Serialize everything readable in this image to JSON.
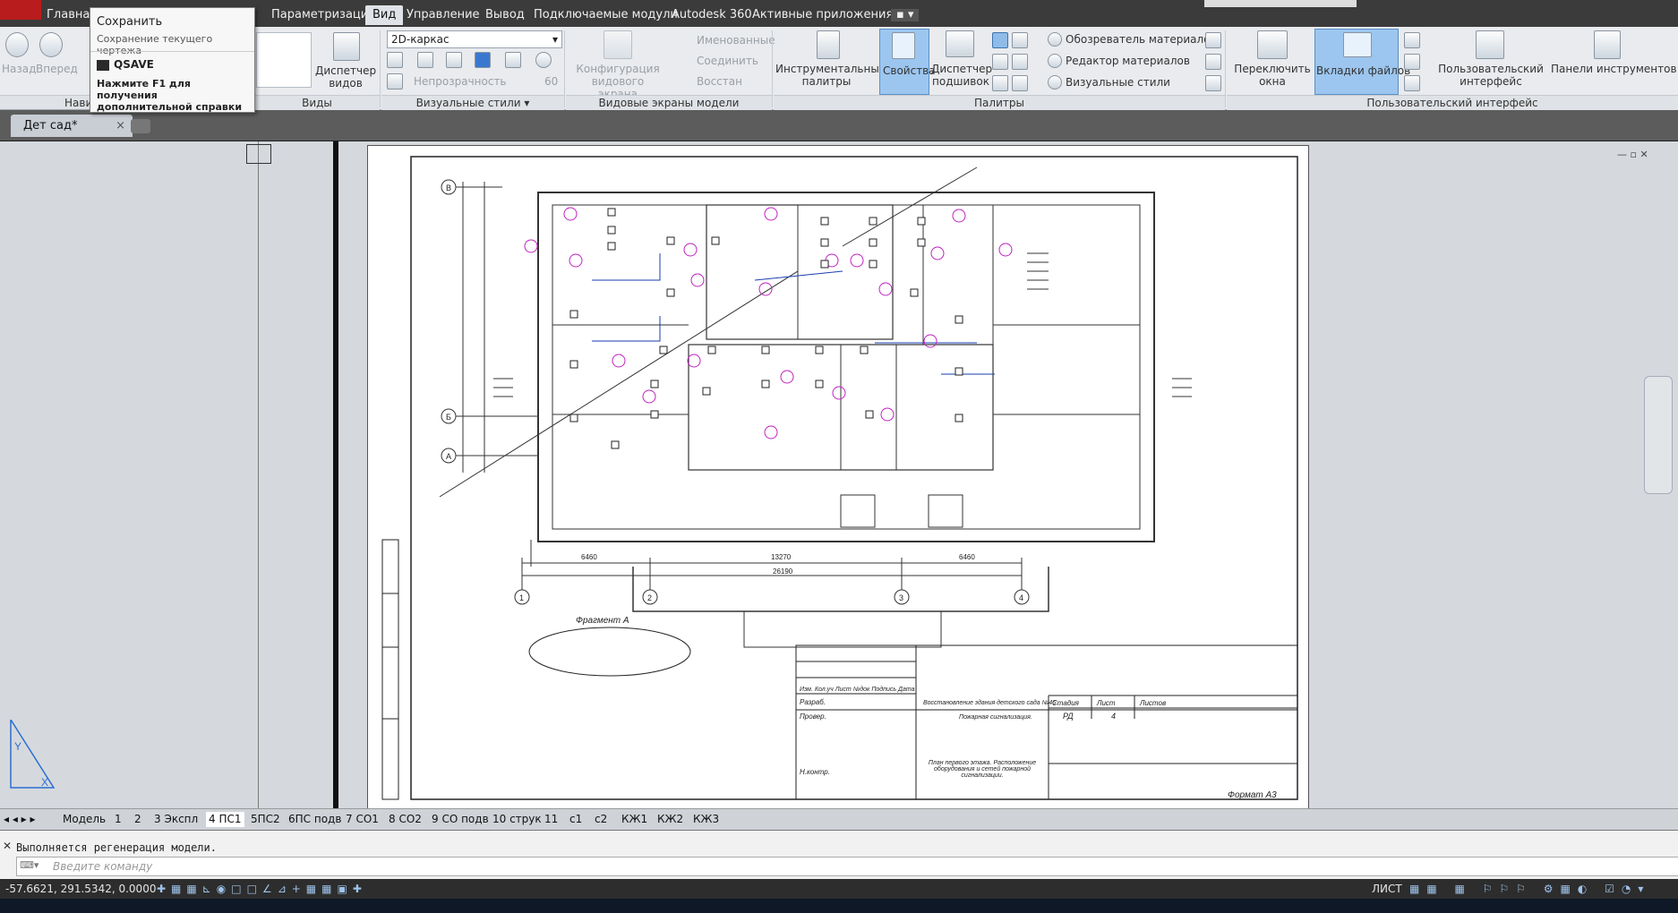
{
  "ribbon_tabs": [
    "Главная",
    "Параметризация",
    "Вид",
    "Управление",
    "Вывод",
    "Подключаемые модули",
    "Autodesk 360",
    "Активные приложения"
  ],
  "active_tab": "Вид",
  "tooltip": {
    "title": "Сохранить",
    "description": "Сохранение текущего чертежа",
    "command": "QSAVE",
    "help": "Нажмите F1 для получения дополнительной справки"
  },
  "ribbon": {
    "nav": {
      "back": "Назад",
      "forward": "Вперед",
      "label": "Нави"
    },
    "views": {
      "manager": "Диспетчер видов",
      "label": "Виды"
    },
    "visual_styles": {
      "combo_value": "2D-каркас",
      "opacity": "Непрозрачность",
      "opacity_value": "60",
      "label": "Визуальные стили"
    },
    "viewports": {
      "config": "Конфигурация видового экрана",
      "named": "Именованные",
      "join": "Соединить",
      "restore": "Восстан",
      "label": "Видовые экраны модели"
    },
    "palettes": {
      "tool_palettes": "Инструментальные палитры",
      "properties": "Свойства",
      "sheet_set": "Диспетчер подшивок",
      "materials_browser": "Обозреватель материалов",
      "materials_editor": "Редактор материалов",
      "visual_styles": "Визуальные стили",
      "label": "Палитры"
    },
    "ui": {
      "switch_windows": "Переключить окна",
      "file_tabs": "Вкладки файлов",
      "user_interface": "Пользовательский интерфейс",
      "toolbars": "Панели инструментов",
      "label": "Пользовательский интерфейс"
    }
  },
  "document_tab": "Дет сад*",
  "drawing": {
    "grid_axes": [
      "1",
      "2",
      "3",
      "4",
      "А",
      "Б",
      "В"
    ],
    "dims_bottom": [
      "6460",
      "13270",
      "6460"
    ],
    "dim_total": "26190",
    "fragment_label": "Фрагмент А",
    "title_block": {
      "project": "Восстановление здания детского сада №46.",
      "system": "Пожарная сигнализация.",
      "sheet_desc": "План первого этажа. Расположение оборудования и сетей пожарной сигнализации.",
      "stage_hdr": "Стадия",
      "sheet_hdr": "Лист",
      "sheets_hdr": "Листов",
      "stage": "РД",
      "sheet_no": "4",
      "rows": [
        "Изм.",
        "Кол.уч",
        "Лист",
        "№док",
        "Подпись",
        "Дата"
      ],
      "roles": [
        "Разраб.",
        "Провер.",
        "Н.контр."
      ],
      "format": "Формат А3"
    }
  },
  "layout_tabs": [
    "Модель",
    "1",
    "2",
    "3 Экспл",
    "4 ПС1",
    "5ПС2",
    "6ПС подв",
    "7 СО1",
    "8 СО2",
    "9 СО подв",
    "10 струк",
    "11",
    "с1",
    "с2",
    "КЖ1",
    "КЖ2",
    "КЖ3"
  ],
  "active_layout": "4 ПС1",
  "command_history": "Выполняется регенерация модели.",
  "command_placeholder": "Введите команду",
  "coordinates": "-57.6621, 291.5342, 0.0000",
  "space": "ЛИСТ"
}
